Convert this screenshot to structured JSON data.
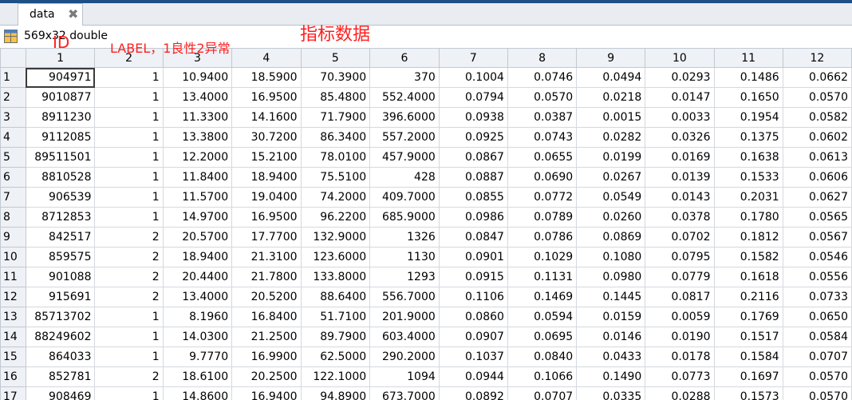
{
  "window": {
    "tab_label": "data"
  },
  "variable": {
    "dims": "569x32 double"
  },
  "annotations": {
    "id": "ID",
    "label": "LABEL，1良性2异常",
    "indicators": "指标数据"
  },
  "colors": {
    "annotation": "#ff2020",
    "header_bg": "#eef1f5",
    "top_strip": "#1e4f86"
  },
  "columns": [
    "1",
    "2",
    "3",
    "4",
    "5",
    "6",
    "7",
    "8",
    "9",
    "10",
    "11",
    "12"
  ],
  "rows": [
    {
      "n": "1",
      "cells": [
        "904971",
        "1",
        "10.9400",
        "18.5900",
        "70.3900",
        "370",
        "0.1004",
        "0.0746",
        "0.0494",
        "0.0293",
        "0.1486",
        "0.0662"
      ]
    },
    {
      "n": "2",
      "cells": [
        "9010877",
        "1",
        "13.4000",
        "16.9500",
        "85.4800",
        "552.4000",
        "0.0794",
        "0.0570",
        "0.0218",
        "0.0147",
        "0.1650",
        "0.0570"
      ]
    },
    {
      "n": "3",
      "cells": [
        "8911230",
        "1",
        "11.3300",
        "14.1600",
        "71.7900",
        "396.6000",
        "0.0938",
        "0.0387",
        "0.0015",
        "0.0033",
        "0.1954",
        "0.0582"
      ]
    },
    {
      "n": "4",
      "cells": [
        "9112085",
        "1",
        "13.3800",
        "30.7200",
        "86.3400",
        "557.2000",
        "0.0925",
        "0.0743",
        "0.0282",
        "0.0326",
        "0.1375",
        "0.0602"
      ]
    },
    {
      "n": "5",
      "cells": [
        "89511501",
        "1",
        "12.2000",
        "15.2100",
        "78.0100",
        "457.9000",
        "0.0867",
        "0.0655",
        "0.0199",
        "0.0169",
        "0.1638",
        "0.0613"
      ]
    },
    {
      "n": "6",
      "cells": [
        "8810528",
        "1",
        "11.8400",
        "18.9400",
        "75.5100",
        "428",
        "0.0887",
        "0.0690",
        "0.0267",
        "0.0139",
        "0.1533",
        "0.0606"
      ]
    },
    {
      "n": "7",
      "cells": [
        "906539",
        "1",
        "11.5700",
        "19.0400",
        "74.2000",
        "409.7000",
        "0.0855",
        "0.0772",
        "0.0549",
        "0.0143",
        "0.2031",
        "0.0627"
      ]
    },
    {
      "n": "8",
      "cells": [
        "8712853",
        "1",
        "14.9700",
        "16.9500",
        "96.2200",
        "685.9000",
        "0.0986",
        "0.0789",
        "0.0260",
        "0.0378",
        "0.1780",
        "0.0565"
      ]
    },
    {
      "n": "9",
      "cells": [
        "842517",
        "2",
        "20.5700",
        "17.7700",
        "132.9000",
        "1326",
        "0.0847",
        "0.0786",
        "0.0869",
        "0.0702",
        "0.1812",
        "0.0567"
      ]
    },
    {
      "n": "10",
      "cells": [
        "859575",
        "2",
        "18.9400",
        "21.3100",
        "123.6000",
        "1130",
        "0.0901",
        "0.1029",
        "0.1080",
        "0.0795",
        "0.1582",
        "0.0546"
      ]
    },
    {
      "n": "11",
      "cells": [
        "901088",
        "2",
        "20.4400",
        "21.7800",
        "133.8000",
        "1293",
        "0.0915",
        "0.1131",
        "0.0980",
        "0.0779",
        "0.1618",
        "0.0556"
      ]
    },
    {
      "n": "12",
      "cells": [
        "915691",
        "2",
        "13.4000",
        "20.5200",
        "88.6400",
        "556.7000",
        "0.1106",
        "0.1469",
        "0.1445",
        "0.0817",
        "0.2116",
        "0.0733"
      ]
    },
    {
      "n": "13",
      "cells": [
        "85713702",
        "1",
        "8.1960",
        "16.8400",
        "51.7100",
        "201.9000",
        "0.0860",
        "0.0594",
        "0.0159",
        "0.0059",
        "0.1769",
        "0.0650"
      ]
    },
    {
      "n": "14",
      "cells": [
        "88249602",
        "1",
        "14.0300",
        "21.2500",
        "89.7900",
        "603.4000",
        "0.0907",
        "0.0695",
        "0.0146",
        "0.0190",
        "0.1517",
        "0.0584"
      ]
    },
    {
      "n": "15",
      "cells": [
        "864033",
        "1",
        "9.7770",
        "16.9900",
        "62.5000",
        "290.2000",
        "0.1037",
        "0.0840",
        "0.0433",
        "0.0178",
        "0.1584",
        "0.0707"
      ]
    },
    {
      "n": "16",
      "cells": [
        "852781",
        "2",
        "18.6100",
        "20.2500",
        "122.1000",
        "1094",
        "0.0944",
        "0.1066",
        "0.1490",
        "0.0773",
        "0.1697",
        "0.0570"
      ]
    },
    {
      "n": "17",
      "cells": [
        "908469",
        "1",
        "14.8600",
        "16.9400",
        "94.8900",
        "673.7000",
        "0.0892",
        "0.0707",
        "0.0335",
        "0.0288",
        "0.1573",
        "0.0570"
      ]
    }
  ]
}
